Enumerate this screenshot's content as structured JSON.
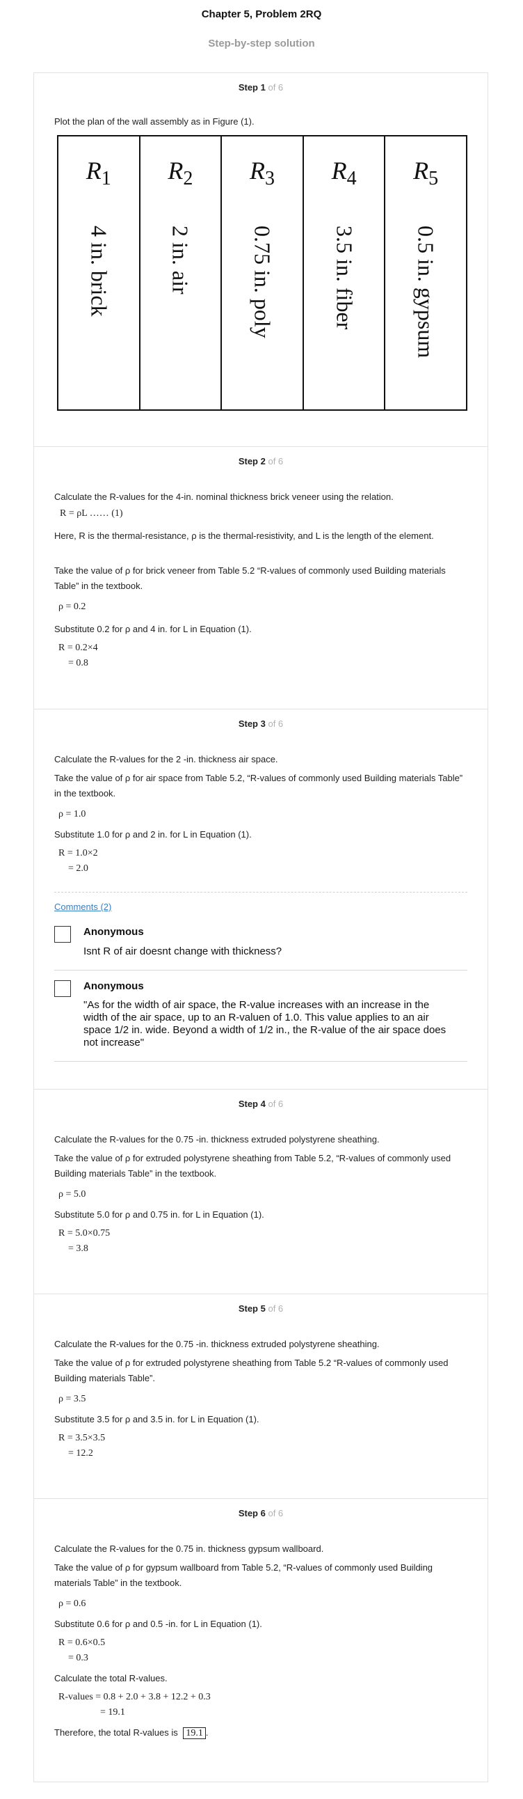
{
  "header": {
    "title": "Chapter 5, Problem 2RQ",
    "subtitle": "Step-by-step solution"
  },
  "steps": [
    {
      "label": "Step 1",
      "of": "of 6",
      "text1": "Plot the plan of the wall assembly as in Figure (1).",
      "figure": {
        "columns": [
          {
            "r": "R",
            "sub": "1",
            "text": "4 in. brick"
          },
          {
            "r": "R",
            "sub": "2",
            "text": "2 in. air"
          },
          {
            "r": "R",
            "sub": "3",
            "text": "0.75 in. poly"
          },
          {
            "r": "R",
            "sub": "4",
            "text": "3.5 in. fiber"
          },
          {
            "r": "R",
            "sub": "5",
            "text": "0.5 in. gypsum"
          }
        ]
      }
    },
    {
      "label": "Step 2",
      "of": "of 6",
      "p1": "Calculate the R-values for the 4-in. nominal thickness brick veneer using the relation.",
      "eq1": "R = ρL …… (1)",
      "p2": "Here, R is the thermal-resistance,  ρ  is the thermal-resistivity, and L is the length of the element.",
      "p3": "Take the value of  ρ  for brick veneer from Table 5.2 “R-values of commonly used Building materials Table” in the textbook.",
      "eq2": "ρ = 0.2",
      "p4": "Substitute 0.2 for  ρ  and 4 in. for L in Equation (1).",
      "eq3": "R = 0.2×4",
      "eq4": "= 0.8"
    },
    {
      "label": "Step 3",
      "of": "of 6",
      "p1": "Calculate the R-values for the 2 -in. thickness air space.",
      "p2": "Take the value of  ρ  for air space from Table 5.2, “R-values of commonly used Building materials Table” in the textbook.",
      "eq1": "ρ = 1.0",
      "p3": "Substitute 1.0 for  ρ  and 2 in. for L in Equation (1).",
      "eq2": "R = 1.0×2",
      "eq3": "= 2.0",
      "comments_link": "Comments (2)",
      "comments": [
        {
          "name": "Anonymous",
          "text": "Isnt R of air doesnt change with thickness?"
        },
        {
          "name": "Anonymous",
          "text": "\"As for the width of air space, the R-value increases with an increase in the width of the air space, up to an R-valuen of 1.0. This value applies to an air space 1/2 in. wide. Beyond a width of 1/2 in., the R-value of the air space does not increase\""
        }
      ]
    },
    {
      "label": "Step 4",
      "of": "of 6",
      "p1": "Calculate the R-values for the 0.75 -in. thickness extruded polystyrene sheathing.",
      "p2": "Take the value of  ρ  for extruded polystyrene sheathing from Table 5.2, “R-values of commonly used Building materials Table” in the textbook.",
      "eq1": "ρ = 5.0",
      "p3": "Substitute 5.0 for  ρ  and 0.75 in. for L in Equation (1).",
      "eq2": "R = 5.0×0.75",
      "eq3": "= 3.8"
    },
    {
      "label": "Step 5",
      "of": "of 6",
      "p1": "Calculate the R-values for the 0.75 -in. thickness extruded polystyrene sheathing.",
      "p2": "Take the value of  ρ  for extruded polystyrene sheathing from Table 5.2 “R-values of commonly used Building materials Table”.",
      "eq1": "ρ = 3.5",
      "p3": "Substitute 3.5 for  ρ  and 3.5 in. for L in Equation (1).",
      "eq2": "R = 3.5×3.5",
      "eq3": "= 12.2"
    },
    {
      "label": "Step 6",
      "of": "of 6",
      "p1": "Calculate the R-values for the 0.75 in. thickness gypsum wallboard.",
      "p2": "Take the value of  ρ  for gypsum wallboard from Table 5.2, “R-values of commonly used Building materials Table” in the textbook.",
      "eq1": "ρ = 0.6",
      "p3": "Substitute 0.6 for  ρ  and 0.5 -in. for L in Equation (1).",
      "eq2": "R = 0.6×0.5",
      "eq3": "= 0.3",
      "p4": "Calculate the total R-values.",
      "eq4": "R-values = 0.8 + 2.0 + 3.8 + 12.2 + 0.3",
      "eq5": "= 19.1",
      "p5": "Therefore, the total R-values is",
      "answer": "19.1"
    }
  ]
}
